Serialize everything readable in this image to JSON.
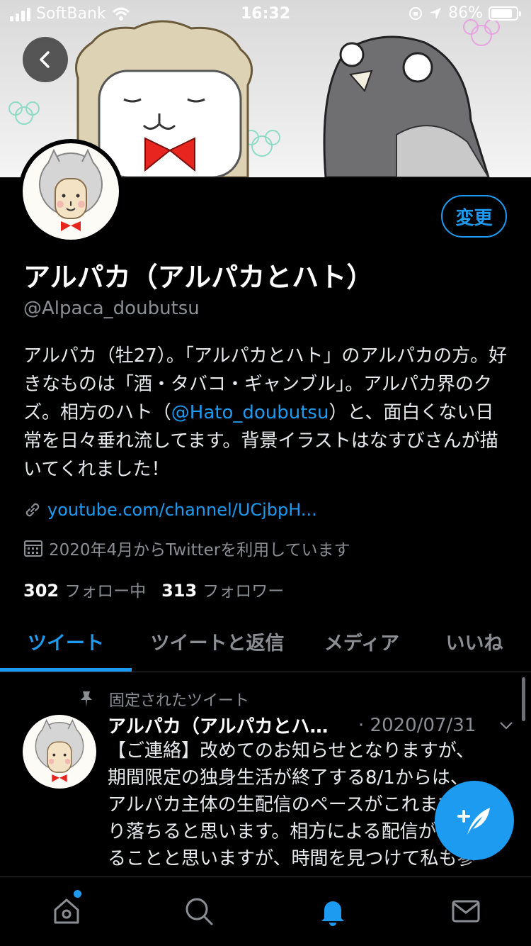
{
  "status_bar": {
    "carrier": "SoftBank",
    "time": "16:32",
    "battery": "86%",
    "battery_level": 0.86
  },
  "profile": {
    "edit_label": "変更",
    "display_name": "アルパカ（アルパカとハト）",
    "handle": "@Alpaca_doubutsu",
    "bio_part1": "アルパカ（牡27）。「アルパカとハト」のアルパカの方。好きなものは「酒・タバコ・ギャンブル」。アルパカ界のクズ。相方のハト（",
    "bio_mention": "@Hato_doubutsu",
    "bio_part2": "）と、面白くない日常を日々垂れ流してます。背景イラストはなすびさんが描いてくれました！",
    "link": "youtube.com/channel/UCjbpH...",
    "joined": "2020年4月からTwitterを利用しています",
    "following_count": "302",
    "following_label": "フォロー中",
    "followers_count": "313",
    "followers_label": "フォロワー"
  },
  "tabs": [
    {
      "label": "ツイート",
      "active": true
    },
    {
      "label": "ツイートと返信",
      "active": false
    },
    {
      "label": "メディア",
      "active": false
    },
    {
      "label": "いいね",
      "active": false
    }
  ],
  "tweet": {
    "pinned_label": "固定されたツイート",
    "name": "アルパカ（アルパカとハ…",
    "date": "· 2020/07/31",
    "body_lines": [
      "【ご連絡】改めてのお知らせとなりますが、",
      "期間限定の独身生活が終了する8/1からは、",
      "アルパカ主体の生配信のペースがこれまでよ",
      "り落ちると思います。相方による配信が増え",
      "ることと思いますが、時間を見つけて私も参"
    ]
  },
  "colors": {
    "accent": "#1d9bf0",
    "background": "#000000",
    "muted_text": "#8b8f94"
  },
  "icons": {
    "back": "chevron-left-icon",
    "link": "link-icon",
    "calendar": "calendar-icon",
    "pin": "pin-icon",
    "compose": "compose-tweet-icon",
    "home": "home-icon",
    "search": "search-icon",
    "notifications": "bell-icon",
    "messages": "mail-icon"
  }
}
